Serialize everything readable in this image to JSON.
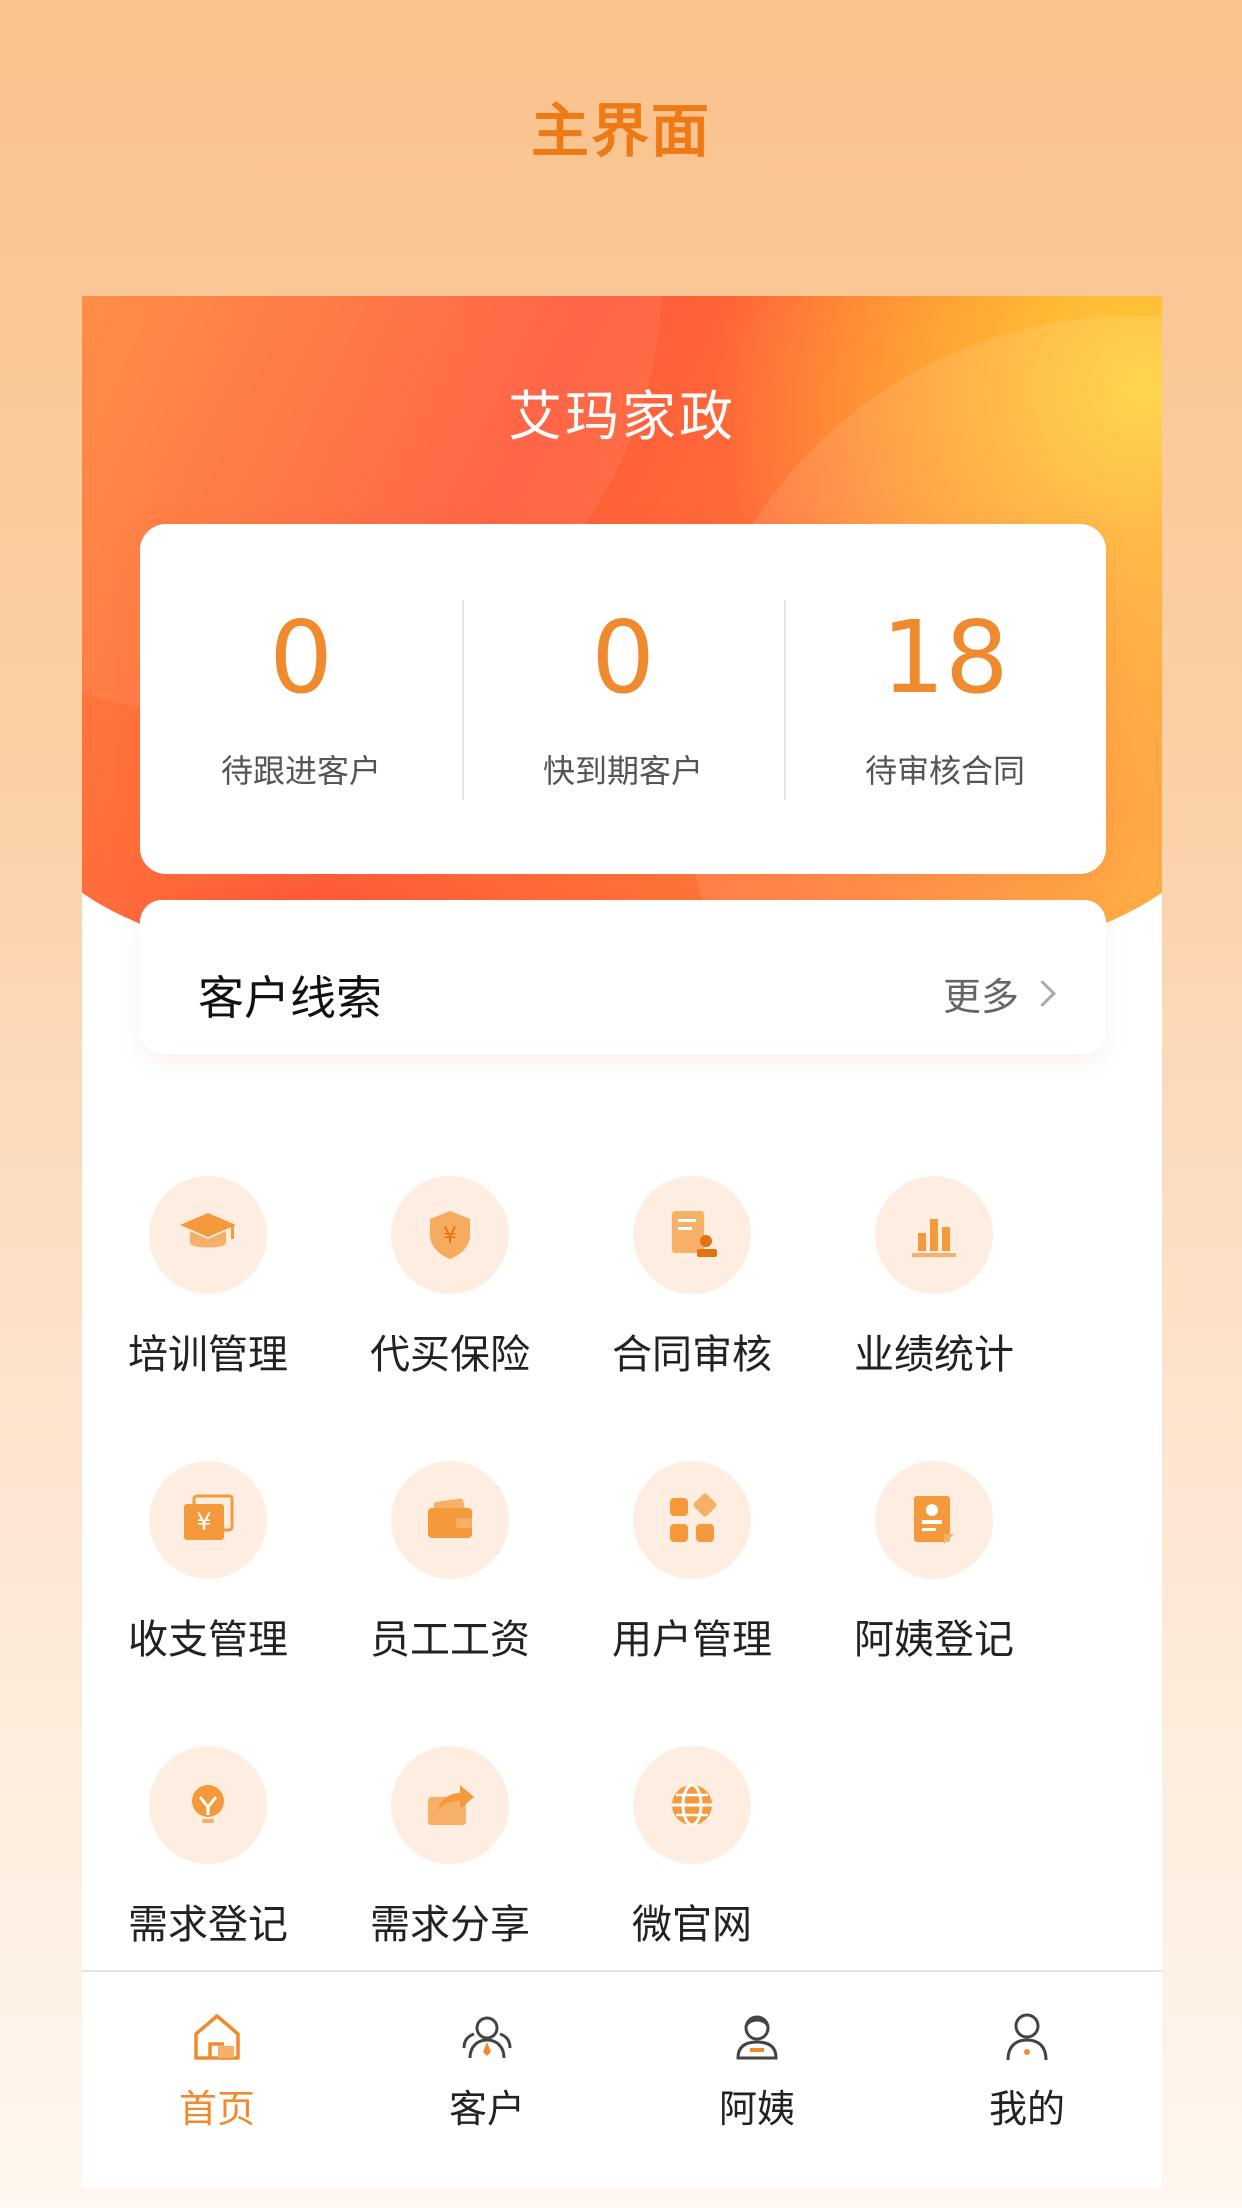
{
  "header": {
    "title": "主界面"
  },
  "banner": {
    "brand": "艾玛家政"
  },
  "stats": [
    {
      "value": "0",
      "label": "待跟进客户"
    },
    {
      "value": "0",
      "label": "快到期客户"
    },
    {
      "value": "18",
      "label": "待审核合同"
    }
  ],
  "leads": {
    "title": "客户线索",
    "more": "更多"
  },
  "menu": [
    {
      "label": "培训管理",
      "icon": "graduation-cap-icon"
    },
    {
      "label": "代买保险",
      "icon": "shield-yen-icon"
    },
    {
      "label": "合同审核",
      "icon": "contract-stamp-icon"
    },
    {
      "label": "业绩统计",
      "icon": "bar-chart-icon"
    },
    {
      "label": "收支管理",
      "icon": "yen-cards-icon"
    },
    {
      "label": "员工工资",
      "icon": "wallet-icon"
    },
    {
      "label": "用户管理",
      "icon": "apps-grid-icon"
    },
    {
      "label": "阿姨登记",
      "icon": "profile-card-icon"
    },
    {
      "label": "需求登记",
      "icon": "lightbulb-icon"
    },
    {
      "label": "需求分享",
      "icon": "share-icon"
    },
    {
      "label": "微官网",
      "icon": "globe-icon"
    }
  ],
  "tabs": [
    {
      "label": "首页",
      "icon": "home-icon",
      "active": true
    },
    {
      "label": "客户",
      "icon": "customers-icon",
      "active": false
    },
    {
      "label": "阿姨",
      "icon": "nanny-icon",
      "active": false
    },
    {
      "label": "我的",
      "icon": "profile-icon",
      "active": false
    }
  ],
  "colors": {
    "accent": "#f08a2e",
    "icon_bg": "#fdeee1",
    "title": "#ee7a16"
  }
}
